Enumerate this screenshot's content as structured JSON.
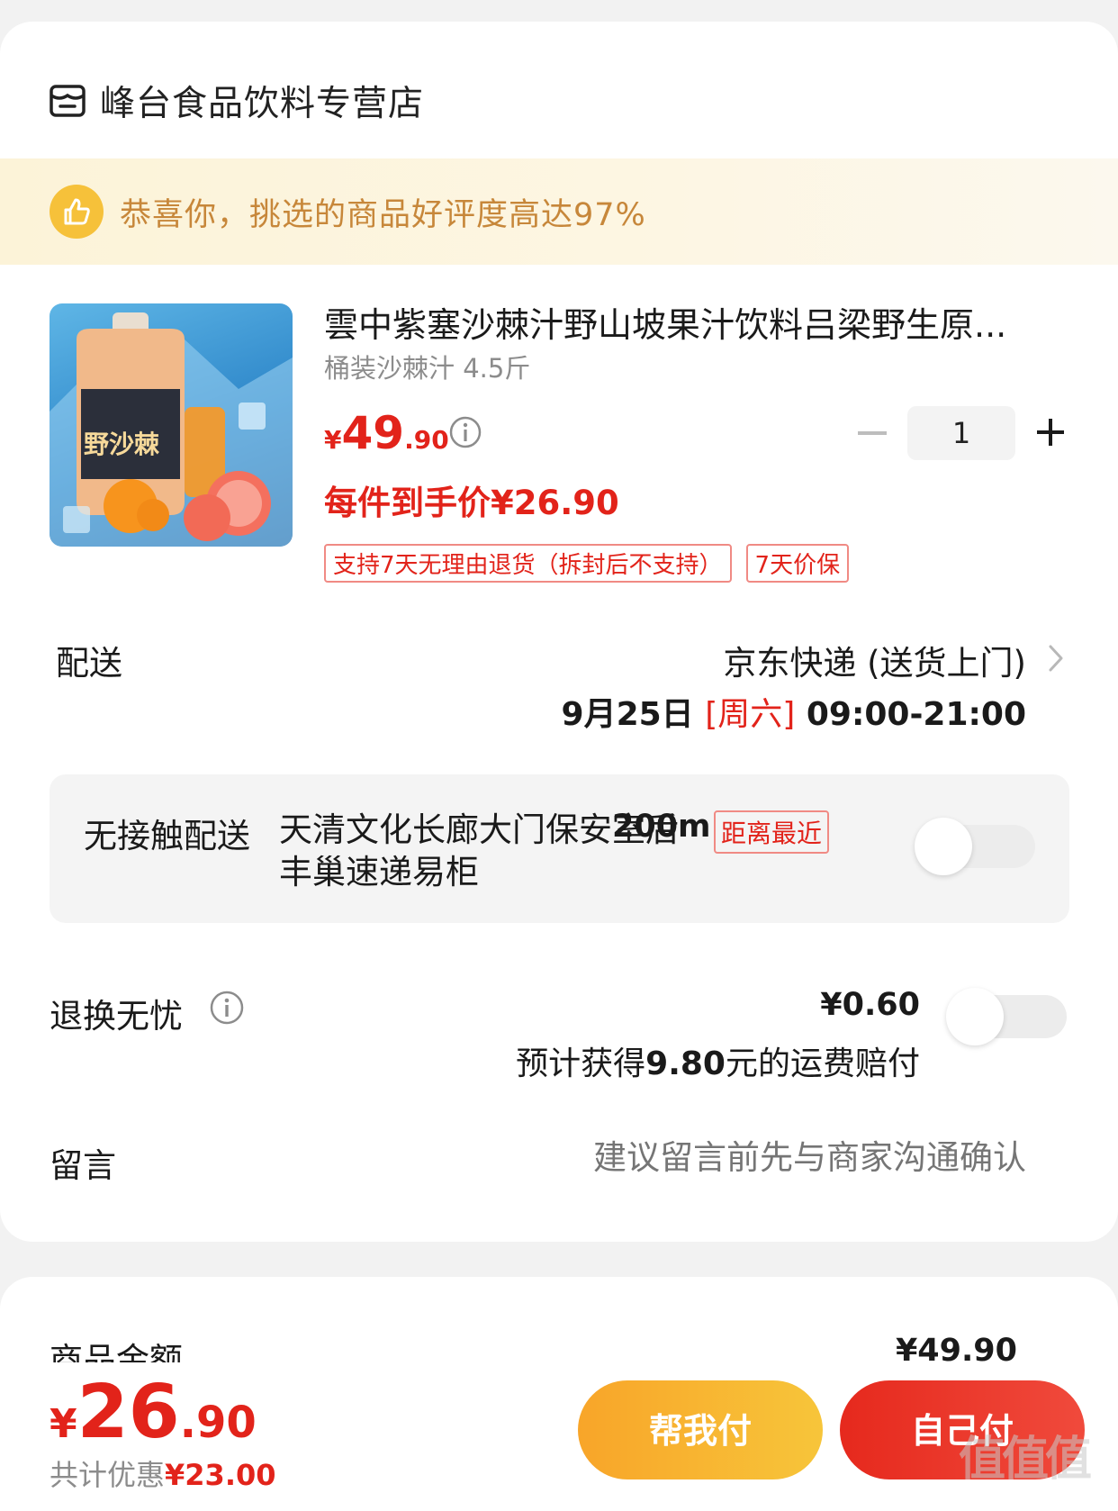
{
  "store": {
    "name": "峰台食品饮料专营店",
    "icon": "store-icon"
  },
  "banner": {
    "text": "恭喜你，挑选的商品好评度高达97%",
    "icon": "thumbs-up-icon",
    "color": "#c7873a"
  },
  "product": {
    "title": "雲中紫塞沙棘汁野山坡果汁饮料吕梁野生原...",
    "spec": "桶装沙棘汁 4.5斤",
    "price_yen": "¥",
    "price_int": "49",
    "price_dec": ".90",
    "net_price": "每件到手价¥26.90",
    "quantity": "1",
    "tags": [
      "支持7天无理由退货（拆封后不支持）",
      "7天价保"
    ],
    "image_label": "野沙棘"
  },
  "shipping": {
    "label": "配送",
    "method": "京东快递 (送货上门)",
    "date": "9月25日",
    "weekday": "[周六]",
    "time": "09:00-21:00"
  },
  "contactless": {
    "label": "无接触配送",
    "place": "天清文化长廊大门保安室后丰巢速递易柜",
    "distance": "200m",
    "badge": "距离最近",
    "enabled": false
  },
  "return_service": {
    "label": "退换无忧",
    "fee": "¥0.60",
    "note_prefix": "预计获得",
    "note_amount": "9.80",
    "note_suffix": "元的运费赔付",
    "enabled": false
  },
  "message": {
    "label": "留言",
    "placeholder": "建议留言前先与商家沟通确认"
  },
  "summary": {
    "amount_label": "商品金额",
    "amount_value": "¥49.90"
  },
  "footer": {
    "total_yen": "¥",
    "total_int": "26",
    "total_dec": ".90",
    "discount_label": "共计优惠",
    "discount_value": "¥23.00",
    "help_pay": "帮我付",
    "self_pay": "自己付"
  },
  "watermark": "值值值",
  "colors": {
    "accent": "#e2231a",
    "help_button": "#f8a529",
    "pay_button": "#e6291d"
  }
}
